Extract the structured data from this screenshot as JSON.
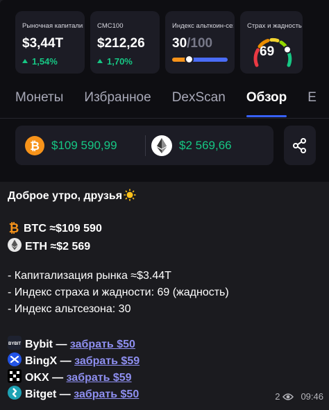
{
  "stats": {
    "market_cap": {
      "label": "Рыночная капитализация",
      "value": "$3,44T",
      "change": "1,54%"
    },
    "cmc100": {
      "label": "CMC100",
      "value": "$212,26",
      "change": "1,70%"
    },
    "altseason": {
      "label": "Индекс альткоин-сезона",
      "value": "30",
      "max": "/100",
      "level": 0.3
    },
    "fear_greed": {
      "label": "Страх и жадность",
      "value": "69",
      "level": 0.69
    }
  },
  "tabs": [
    "Монеты",
    "Избранное",
    "DexScan",
    "Обзор",
    "E"
  ],
  "active_tab": "Обзор",
  "prices": {
    "btc": "$109 590,99",
    "eth": "$2 569,66"
  },
  "colors": {
    "accent": "#3861fb",
    "positive": "#16c784",
    "btc": "#f7931a",
    "link": "#8e8ff0"
  },
  "message": {
    "greeting": "Доброе утро, друзья",
    "btc_line": "BTC ≈$109 590",
    "eth_line": "ETH ≈$2 569",
    "market_cap_line": "- Капитализация рынка ≈$3.44T",
    "fear_line": "- Индекс страха и жадности: 69 (жадность)",
    "alt_line": "- Индекс альтсезона: 30",
    "promos": [
      {
        "name": "Bybit",
        "sep": " — ",
        "link": "забрать $50",
        "icon": "bybit-icon"
      },
      {
        "name": "BingX",
        "sep": " — ",
        "link": "забрать $59",
        "icon": "bingx-icon"
      },
      {
        "name": "OKX",
        "sep": " — ",
        "link": "забрать $59",
        "icon": "okx-icon"
      },
      {
        "name": "Bitget",
        "sep": " — ",
        "link": "забрать $50",
        "icon": "bitget-icon"
      }
    ],
    "views": "2",
    "time": "09:46"
  }
}
